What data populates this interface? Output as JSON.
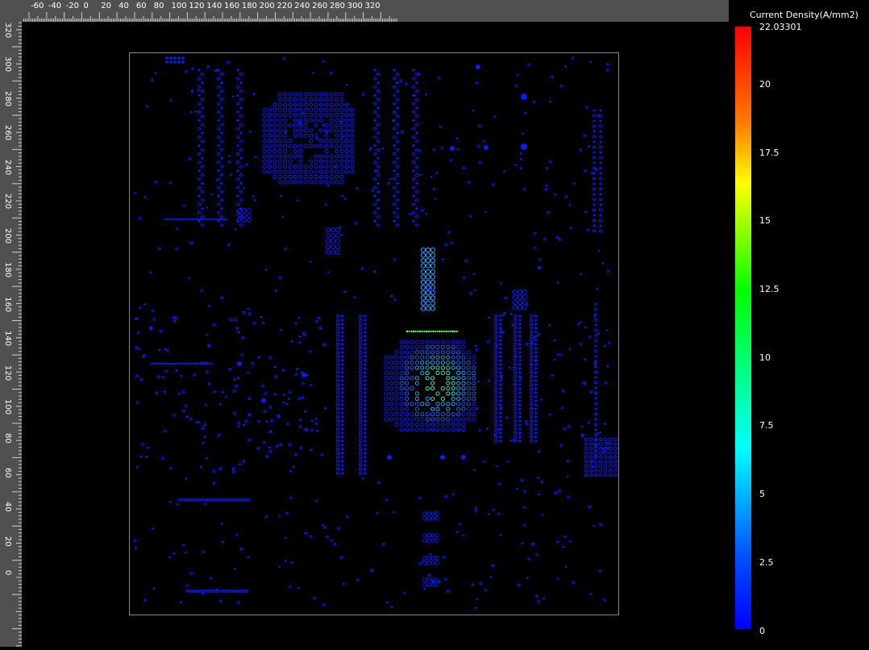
{
  "ruler_top": {
    "labels": [
      "-60",
      "-40",
      "-20",
      "0",
      "20",
      "40",
      "60",
      "80",
      "100",
      "120",
      "140",
      "160",
      "180",
      "200",
      "220",
      "240",
      "260",
      "280",
      "300",
      "320"
    ]
  },
  "ruler_left": {
    "labels": [
      "320",
      "300",
      "280",
      "260",
      "240",
      "220",
      "200",
      "180",
      "160",
      "140",
      "120",
      "100",
      "80",
      "60",
      "40",
      "20",
      "0"
    ]
  },
  "legend": {
    "title": "Current Density(A/mm2)",
    "values": [
      "22.03301",
      "20",
      "17.5",
      "15",
      "12.5",
      "10",
      "7.5",
      "5",
      "2.5",
      "0"
    ],
    "colors": {
      "max": "#ff0000",
      "high": "#ff7a00",
      "mid_high": "#ffff00",
      "mid": "#00ff00",
      "mid_low": "#00ffff",
      "low": "#0000ff"
    }
  },
  "colors": {
    "ruler_bg": "#505050",
    "canvas_bg": "#000000",
    "board_outline": "#8a8a8a",
    "via_base": "#0a1cff",
    "via_bright": "#00d8ff",
    "hot_spot": "#40e0c0"
  }
}
